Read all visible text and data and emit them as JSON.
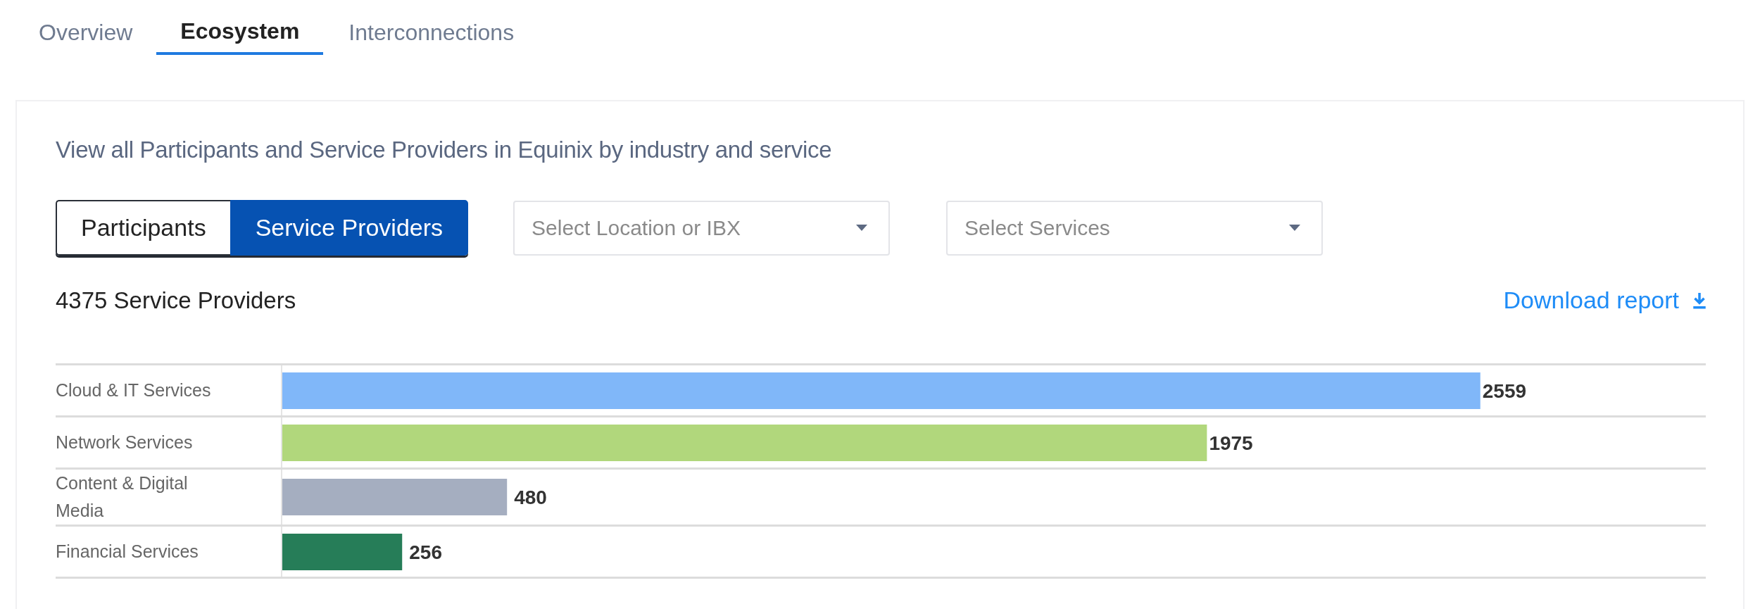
{
  "tabs": [
    {
      "label": "Overview",
      "selected": false
    },
    {
      "label": "Ecosystem",
      "selected": true
    },
    {
      "label": "Interconnections",
      "selected": false
    }
  ],
  "panel": {
    "description": "View all Participants and Service Providers in Equinix by industry and service",
    "toggle": [
      {
        "label": "Participants",
        "selected": false
      },
      {
        "label": "Service Providers",
        "selected": true
      }
    ],
    "selects": [
      {
        "placeholder": "Select Location or IBX"
      },
      {
        "placeholder": "Select Services"
      }
    ],
    "count": "4375 Service Providers",
    "download": "Download report",
    "chart_data": {
      "type": "bar",
      "orientation": "horizontal",
      "data_labels": true,
      "grid": true,
      "categories": [
        "Cloud & IT Services",
        "Network Services",
        "Content & Digital Media",
        "Financial Services"
      ],
      "values": [
        2559,
        1975,
        480,
        256
      ],
      "colors": [
        "#80b7f9",
        "#b1d77c",
        "#a5aec0",
        "#267d58"
      ]
    }
  }
}
